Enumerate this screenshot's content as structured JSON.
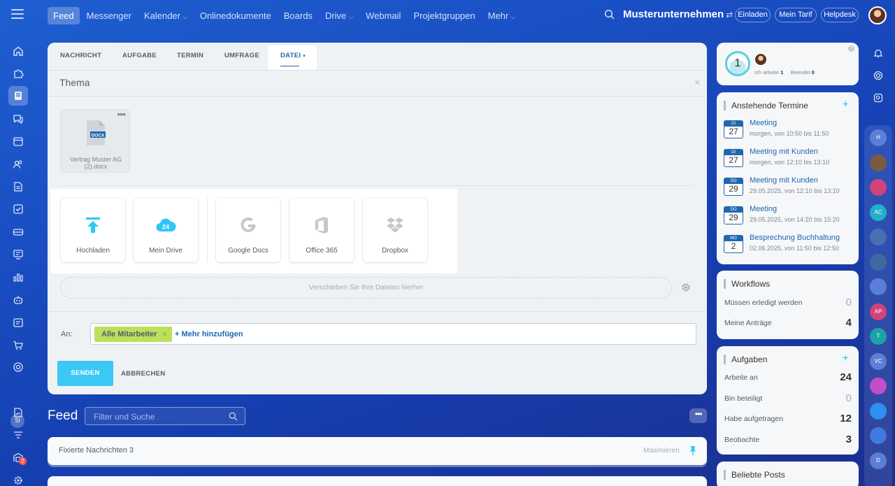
{
  "topbar": {
    "nav": [
      {
        "label": "Feed",
        "active": true,
        "dropdown": false
      },
      {
        "label": "Messenger",
        "active": false,
        "dropdown": false
      },
      {
        "label": "Kalender",
        "active": false,
        "dropdown": true
      },
      {
        "label": "Onlinedokumente",
        "active": false,
        "dropdown": false
      },
      {
        "label": "Boards",
        "active": false,
        "dropdown": false
      },
      {
        "label": "Drive",
        "active": false,
        "dropdown": true
      },
      {
        "label": "Webmail",
        "active": false,
        "dropdown": false
      },
      {
        "label": "Projektgruppen",
        "active": false,
        "dropdown": false
      },
      {
        "label": "Mehr",
        "active": false,
        "dropdown": true
      }
    ],
    "company": "Musterunternehmen",
    "invite": "Einladen",
    "tariff": "Mein Tarif",
    "helpdesk": "Helpdesk"
  },
  "left_sidebar": {
    "icons": [
      "home-icon",
      "puzzle-icon",
      "feed-icon",
      "chat-icon",
      "calendar-icon",
      "contacts-icon",
      "document-icon",
      "tasks-icon",
      "drive-icon",
      "monitor-icon",
      "chart-icon",
      "robot-icon",
      "planner-icon",
      "cart-icon",
      "target-icon",
      "si-avatar",
      "sign-icon",
      "filter-icon",
      "warehouse-icon",
      "settings-icon"
    ],
    "avatar_initials": "SI",
    "badge": "2"
  },
  "composer": {
    "tabs": [
      "NACHRICHT",
      "AUFGABE",
      "TERMIN",
      "UMFRAGE",
      "DATEI"
    ],
    "active_tab": "DATEI",
    "subject": "Thema",
    "file": {
      "type": "DOCX",
      "name": "Vertrag Muster AG (2).docx"
    },
    "sources": [
      "Hochladen",
      "Mein Drive",
      "Google Docs",
      "Office 365",
      "Dropbox"
    ],
    "drive_badge": "24",
    "dropzone": "Verschieben Sie Ihre Dateien hierher",
    "to_label": "An:",
    "recipient": "Alle Mitarbeiter",
    "add_more": "+ Mehr hinzufügen",
    "send": "SENDEN",
    "cancel": "ABBRECHEN"
  },
  "feed": {
    "title": "Feed",
    "search_placeholder": "Filter und Suche",
    "pinned": "Fixierte Nachrichten 3",
    "maximize": "Maximieren"
  },
  "timeman": {
    "count": "1",
    "working_label": "Ich arbeite",
    "working_value": "1",
    "done_label": "Beendet",
    "done_value": "0"
  },
  "events": {
    "title": "Anstehende Termine",
    "items": [
      {
        "dow": "DI",
        "day": "27",
        "title": "Meeting",
        "time": "morgen, von 10:50 bis 11:50"
      },
      {
        "dow": "DI",
        "day": "27",
        "title": "Meeting mit Kunden",
        "time": "morgen, von 12:10 bis 13:10"
      },
      {
        "dow": "DO",
        "day": "29",
        "title": "Meeting mit Kunden",
        "time": "29.05.2025, von 12:10 bis 13:10"
      },
      {
        "dow": "DO",
        "day": "29",
        "title": "Meeting",
        "time": "29.05.2025, von 14:20 bis 15:20"
      },
      {
        "dow": "MO",
        "day": "2",
        "title": "Besprechung Buchhaltung",
        "time": "02.06.2025, von 11:50 bis 12:50"
      }
    ]
  },
  "workflows": {
    "title": "Workflows",
    "rows": [
      {
        "label": "Müssen erledigt werden",
        "value": "0"
      },
      {
        "label": "Meine Anträge",
        "value": "4"
      }
    ]
  },
  "tasks": {
    "title": "Aufgaben",
    "rows": [
      {
        "label": "Arbeite an",
        "value": "24"
      },
      {
        "label": "Bin beteiligt",
        "value": "0"
      },
      {
        "label": "Habe aufgetragen",
        "value": "12"
      },
      {
        "label": "Beobachte",
        "value": "3"
      }
    ]
  },
  "popular": {
    "title": "Beliebte Posts"
  },
  "right_sidebar": {
    "avatars": [
      {
        "initials": "H",
        "color": "#5b7fd6"
      },
      {
        "initials": "",
        "color": "#7a5a40"
      },
      {
        "initials": "",
        "color": "#d2437a"
      },
      {
        "initials": "AC",
        "color": "#22b0c8"
      },
      {
        "initials": "",
        "color": "#4a6fb0"
      },
      {
        "initials": "",
        "color": "#3d6a9e"
      },
      {
        "initials": "",
        "color": "#5b7fd6"
      },
      {
        "initials": "AP",
        "color": "#d2437a"
      },
      {
        "initials": "T",
        "color": "#1aa3a8"
      },
      {
        "initials": "VC",
        "color": "#5b7fd6"
      },
      {
        "initials": "",
        "color": "#c04fc9"
      },
      {
        "initials": "",
        "color": "#2d8ff0"
      },
      {
        "initials": "",
        "color": "#3f7ae0"
      },
      {
        "initials": "D",
        "color": "#5b7fd6"
      }
    ]
  },
  "colors": {
    "accent": "#3bc8f5",
    "link": "#2067b0",
    "recipient_tag": "#bce05c"
  }
}
